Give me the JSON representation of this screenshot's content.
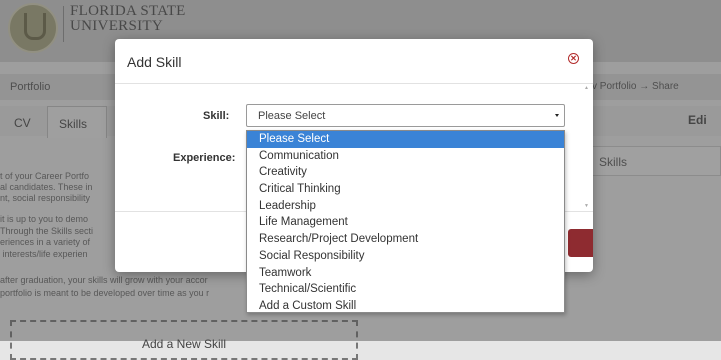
{
  "header": {
    "university_line1": "FLORIDA STATE",
    "university_line2": "UNIVERSITY"
  },
  "nav": {
    "portfolio_label": "Portfolio",
    "share_label": "v Portfolio → Share"
  },
  "tabs": [
    {
      "label": "CV"
    },
    {
      "label": "Skills"
    }
  ],
  "edit_label": "Edi",
  "skills_heading": "Skills",
  "intro_lines": [
    "t of your Career Portfo",
    "al candidates. These in",
    "nt, social responsibility",
    "",
    "it is up to you to demo",
    "Through the Skills secti",
    "eriences in a variety of",
    " interests/life experien",
    "",
    "after graduation, your skills will grow with your accor",
    "portfolio is meant to be developed over time as you r"
  ],
  "add_skill_button": "Add a New Skill",
  "modal": {
    "title": "Add Skill",
    "skill_label": "Skill:",
    "experience_label": "Experience:",
    "selected_value": "Please Select",
    "options": [
      "Please Select",
      "Communication",
      "Creativity",
      "Critical Thinking",
      "Leadership",
      "Life Management",
      "Research/Project Development",
      "Social Responsibility",
      "Teamwork",
      "Technical/Scientific",
      "Add a Custom Skill"
    ],
    "highlighted_option_index": 0
  },
  "colors": {
    "highlight": "#3a83d6",
    "close_icon": "#b22b2b",
    "save_button": "#8e2b30"
  }
}
